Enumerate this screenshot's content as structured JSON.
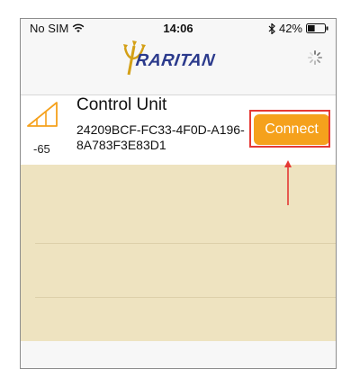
{
  "status_bar": {
    "carrier": "No SIM",
    "time": "14:06",
    "battery_percent": "42%",
    "battery_level": 0.42,
    "icons": [
      "wifi-icon",
      "bluetooth-icon",
      "battery-icon"
    ]
  },
  "nav_bar": {
    "logo_text": "RARITAN",
    "activity_indicator": "spinner-icon"
  },
  "device": {
    "name": "Control Unit",
    "uuid": "24209BCF-FC33-4F0D-A196-8A783F3E83D1",
    "rssi": "-65",
    "connect_label": "Connect",
    "signal_icon": "signal-strength-icon"
  },
  "colors": {
    "accent": "#f5a11c",
    "list_background": "#eee3c0",
    "highlight": "#e53935",
    "logo": "#2b3a8c"
  }
}
